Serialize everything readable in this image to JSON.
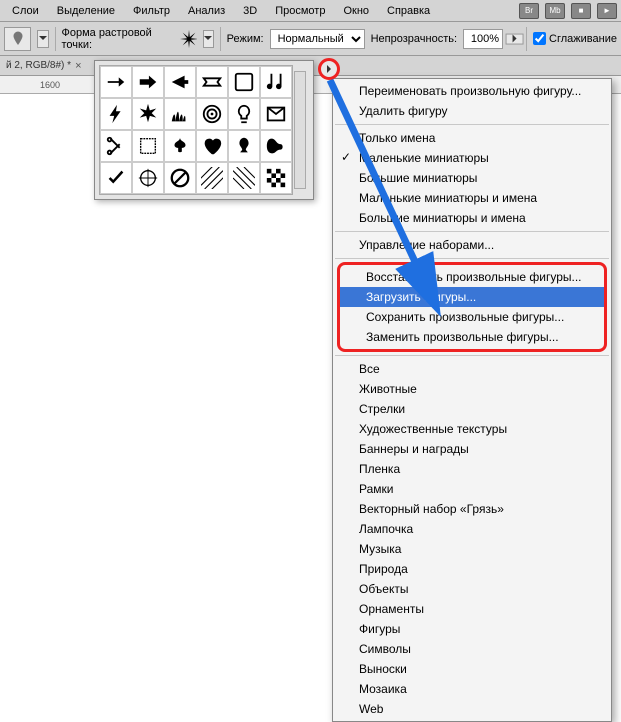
{
  "menu": [
    "Слои",
    "Выделение",
    "Фильтр",
    "Анализ",
    "3D",
    "Просмотр",
    "Окно",
    "Справка"
  ],
  "ribbon": [
    "Br",
    "Mb",
    "■",
    "►"
  ],
  "toolbar": {
    "shape_label": "Форма растровой точки:",
    "mode_label": "Режим:",
    "mode_value": "Нормальный",
    "opacity_label": "Непрозрачность:",
    "opacity_value": "100%",
    "smoothing": "Сглаживание"
  },
  "doc_tab": "й 2, RGB/8#) *",
  "ruler_mark": "1600",
  "context": {
    "group1": [
      "Переименовать произвольную фигуру...",
      "Удалить фигуру"
    ],
    "group2": {
      "items": [
        "Только имена",
        "Маленькие миниатюры",
        "Большие миниатюры",
        "Маленькие миниатюры и имена",
        "Большие миниатюры и имена"
      ],
      "checked": 1
    },
    "group3": [
      "Управление наборами..."
    ],
    "group4": [
      "Восстановить произвольные фигуры...",
      "Загрузить фигуры...",
      "Сохранить произвольные фигуры...",
      "Заменить произвольные фигуры..."
    ],
    "highlight": 1,
    "group5": [
      "Все",
      "Животные",
      "Стрелки",
      "Художественные текстуры",
      "Баннеры и награды",
      "Пленка",
      "Рамки",
      "Векторный набор «Грязь»",
      "Лампочка",
      "Музыка",
      "Природа",
      "Объекты",
      "Орнаменты",
      "Фигуры",
      "Символы",
      "Выноски",
      "Мозаика",
      "Web"
    ]
  },
  "shape_names": [
    "arrow-right-icon",
    "arrow-bold-icon",
    "arrow-pointer-icon",
    "banner-icon",
    "frame-icon",
    "note-icon",
    "lightning-icon",
    "burst-icon",
    "grass-icon",
    "target-icon",
    "lightbulb-icon",
    "envelope-icon",
    "scissors-icon",
    "frame2-icon",
    "fleur-icon",
    "heart-icon",
    "spade-icon",
    "blob-icon",
    "check-icon",
    "crosshair-icon",
    "prohibit-icon",
    "diagonal-icon",
    "diagonal2-icon",
    "checker-icon"
  ]
}
